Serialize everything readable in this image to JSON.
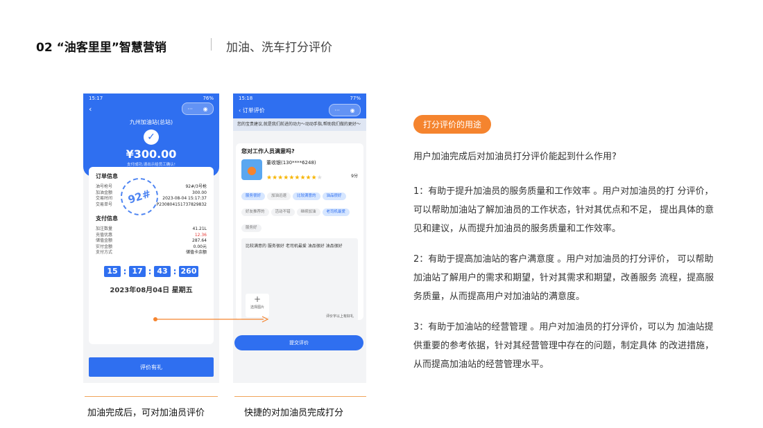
{
  "header": {
    "title": "02 “油客里里”智慧营销",
    "subtitle": "加油、洗车打分评价"
  },
  "phone1": {
    "time": "15:17",
    "battery": "76%",
    "station": "九州加油站(总站)",
    "amount": "¥300.00",
    "pay_note": "支付成功,请出示给员工确认!",
    "order_title": "订单信息",
    "order_rows": [
      {
        "label": "油号枪号",
        "value": "92#/3号枪"
      },
      {
        "label": "加油金额",
        "value": "300.00"
      },
      {
        "label": "交易时间",
        "value": "2023-08-04 15:17:37"
      },
      {
        "label": "交易单号",
        "value": "P230804151737829832"
      }
    ],
    "stamp": "92#",
    "pay_title": "支付信息",
    "pay_rows": [
      {
        "label": "加注数量",
        "value": "41.21L"
      },
      {
        "label": "充值优惠",
        "value": "12.36"
      },
      {
        "label": "储值金额",
        "value": "287.64"
      },
      {
        "label": "实付金额",
        "value": "0.00元"
      },
      {
        "label": "支付方式",
        "value": "储值卡余额"
      }
    ],
    "clock": [
      "15",
      "17",
      "43",
      "260"
    ],
    "date": "2023年08月04日  星期五",
    "button": "评价有礼"
  },
  "phone2": {
    "time": "15:18",
    "battery": "77%",
    "nav_title": "订单评价",
    "notice": "您的宝贵建议,就是我们前进的动力～动动手指,帮助我们做的更好～",
    "question": "您对工作人员满意吗?",
    "staff": "董收银(130****6248)",
    "score": "9分",
    "tags": [
      {
        "text": "服务很好",
        "on": true
      },
      {
        "text": "加油迅速",
        "on": false
      },
      {
        "text": "比较满意的",
        "on": true
      },
      {
        "text": "油品很好",
        "on": true
      },
      {
        "text": "好友推荐的",
        "on": false
      },
      {
        "text": "活动不错",
        "on": false
      },
      {
        "text": "继续加油",
        "on": false
      },
      {
        "text": "老司机最爱",
        "on": true
      },
      {
        "text": "服务好",
        "on": false
      }
    ],
    "comment": "比较满意的 服务很好 老司机最爱 油品很好 油品很好",
    "upload_label": "选择图片",
    "hint": "评价字以上有好礼",
    "submit": "提交评价"
  },
  "captions": {
    "left": "加油完成后，可对加油员评价",
    "right": "快捷的对加油员完成打分"
  },
  "badge": "打分评价的用途",
  "intro": "用户加油完成后对加油员打分评价能起到什么作用?",
  "points": [
    "1：有助于提升加油员的服务质量和工作效率 。用户对加油员的打 分评价，可以帮助加油站了解加油员的工作状态，针对其优点和不足， 提出具体的意见和建议，从而提升加油员的服务质量和工作效率。",
    "2：有助于提高加油站的客户满意度 。用户对加油员的打分评价， 可以帮助加油站了解用户的需求和期望，针对其需求和期望，改善服务 流程，提高服务质量，从而提高用户对加油站的满意度。",
    "3：有助于加油站的经营管理 。用户对加油员的打分评价，可以为 加油站提供重要的参考依据，针对其经营管理中存在的问题，制定具体 的改进措施，从而提高加油站的经营管理水平。"
  ],
  "colors": {
    "accent": "#f5842e",
    "primary": "#2f6ff0"
  }
}
